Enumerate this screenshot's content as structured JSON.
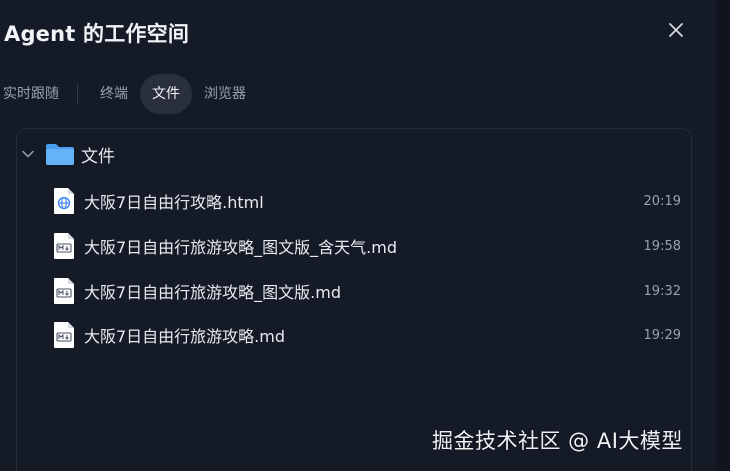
{
  "header": {
    "title": "Agent 的工作空间",
    "close_icon": "close-icon"
  },
  "tabs": [
    {
      "label": "实时跟随",
      "active": false
    },
    {
      "label": "终端",
      "active": false
    },
    {
      "label": "文件",
      "active": true
    },
    {
      "label": "浏览器",
      "active": false
    }
  ],
  "tree": {
    "folder": {
      "label": "文件",
      "expanded": true,
      "icon": "folder-icon"
    },
    "files": [
      {
        "name": "大阪7日自由行攻略.html",
        "time": "20:19",
        "icon": "html-file-icon"
      },
      {
        "name": "大阪7日自由行旅游攻略_图文版_含天气.md",
        "time": "19:58",
        "icon": "markdown-file-icon"
      },
      {
        "name": "大阪7日自由行旅游攻略_图文版.md",
        "time": "19:32",
        "icon": "markdown-file-icon"
      },
      {
        "name": "大阪7日自由行旅游攻略.md",
        "time": "19:29",
        "icon": "markdown-file-icon"
      }
    ]
  },
  "watermark": "掘金技术社区 @ AI大模型",
  "colors": {
    "background": "#151a27",
    "active_tab": "#2a2f3d",
    "folder": "#5aa9f5",
    "html_icon": "#3b82f6"
  }
}
